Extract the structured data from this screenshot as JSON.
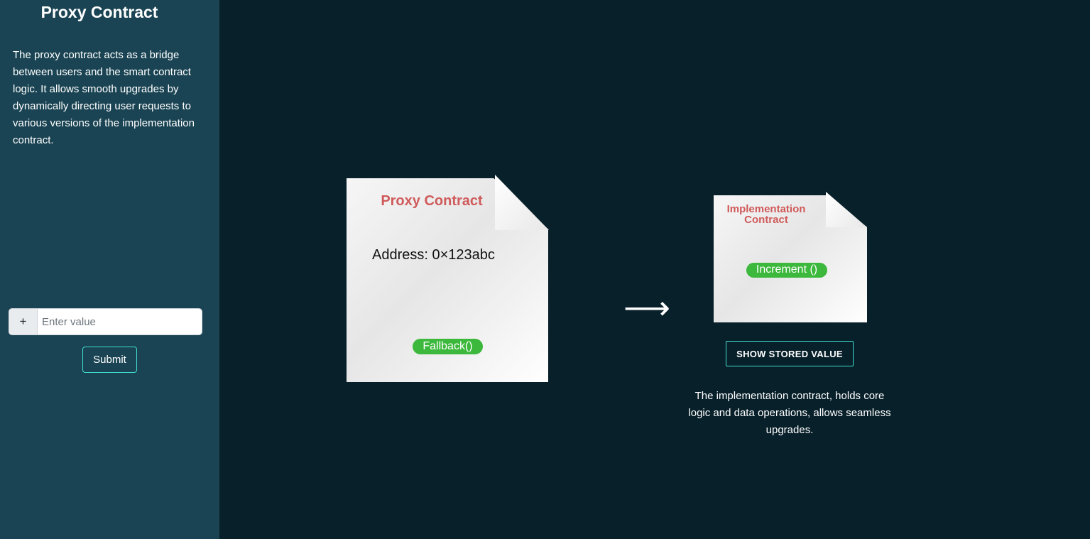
{
  "sidebar": {
    "title": "Proxy Contract",
    "description": "The proxy contract acts as a bridge between users and the smart contract logic. It allows smooth upgrades by dynamically directing user requests to various versions of the implementation contract.",
    "input_addon": "+",
    "input_placeholder": "Enter value",
    "input_value": "",
    "submit_label": "Submit"
  },
  "proxy_card": {
    "title": "Proxy Contract",
    "address": "Address: 0×123abc",
    "fallback_label": "Fallback()"
  },
  "arrow": "⟶",
  "implementation_card": {
    "title": "Implementation Contract",
    "increment_label": "Increment ()",
    "show_button_label": "SHOW STORED VALUE",
    "description": "The implementation contract, holds core logic and data operations, allows seamless upgrades."
  },
  "colors": {
    "sidebar_bg": "#1a4453",
    "page_bg": "#08202a",
    "accent_border": "#3fe0d0",
    "card_title": "#d05a5a",
    "pill_green": "#3cb83c"
  },
  "icons": {
    "input_addon": "plus-icon",
    "flow_arrow": "right-arrow-icon"
  }
}
